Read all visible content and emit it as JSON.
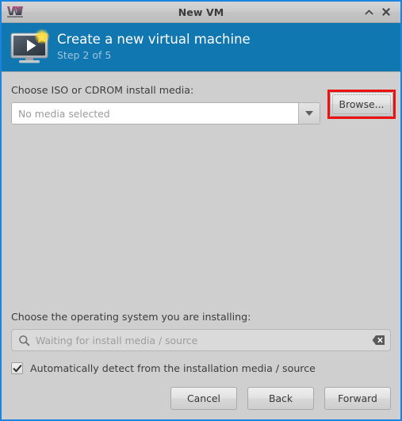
{
  "window": {
    "title": "New VM",
    "app_icon": "virt-manager-icon",
    "shade_button": "shade-window-button",
    "close_button": "close-window-button",
    "border_color": "#1a84de"
  },
  "banner": {
    "icon": "new-virtual-machine-icon",
    "title": "Create a new virtual machine",
    "subtitle": "Step 2 of 5",
    "background_color": "#1177b0",
    "title_color": "#ffffff",
    "subtitle_color": "#9ec4dd"
  },
  "media": {
    "label": "Choose ISO or CDROM install media:",
    "combo_value": "No media selected",
    "combo_placeholder": "No media selected",
    "dropdown_icon": "chevron-down-icon",
    "browse_label": "Browse...",
    "highlight_color": "#ee1111"
  },
  "os": {
    "label": "Choose the operating system you are installing:",
    "search_value": "",
    "search_placeholder": "Waiting for install media / source",
    "search_icon": "search-icon",
    "clear_icon": "clear-entry-icon"
  },
  "autodetect": {
    "label": "Automatically detect from the installation media / source",
    "checked": true,
    "check_glyph": "✔"
  },
  "footer": {
    "cancel_label": "Cancel",
    "back_label": "Back",
    "forward_label": "Forward"
  }
}
